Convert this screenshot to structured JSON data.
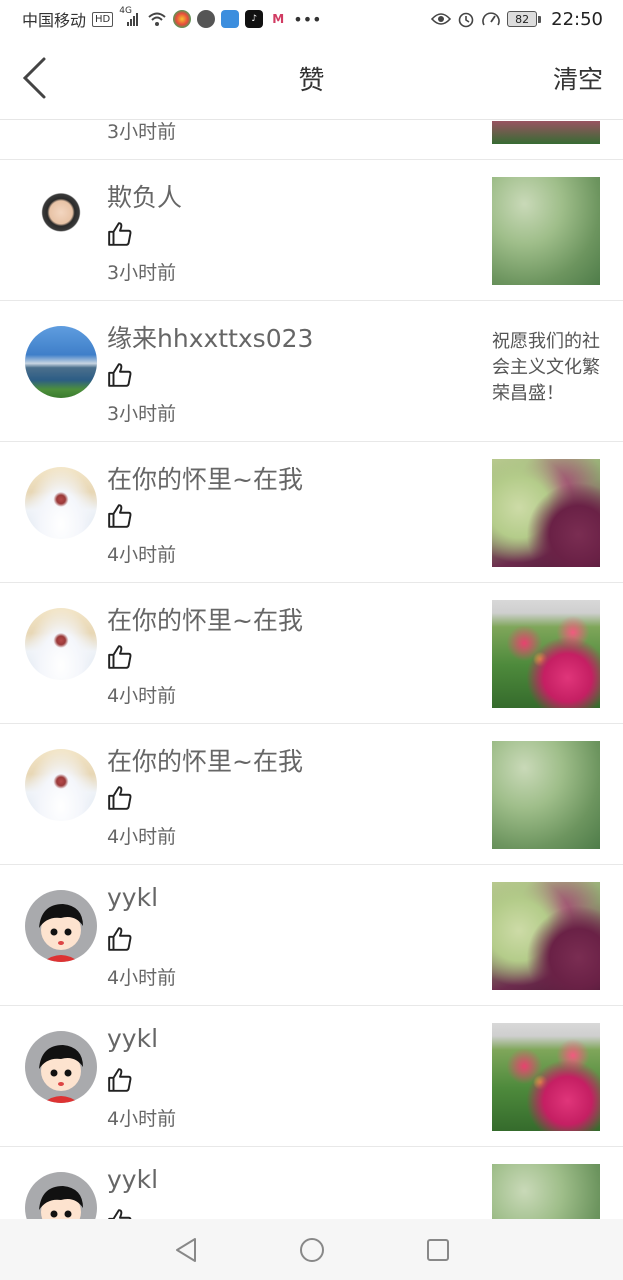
{
  "status_bar": {
    "carrier": "中国移动",
    "hd": "HD",
    "network": "4G",
    "battery": "82",
    "time": "22:50"
  },
  "header": {
    "title": "赞",
    "clear_label": "清空"
  },
  "rows": [
    {
      "user": "",
      "time": "3小时前",
      "avatar": "avatar-unknown",
      "thumb": "th-top"
    },
    {
      "user": "欺负人",
      "time": "3小时前",
      "avatar": "av-girl",
      "thumb": "th-plant"
    },
    {
      "user": "缘来hhxxttxs023",
      "time": "3小时前",
      "avatar": "av-lake",
      "text": "祝愿我们的社会主义文化繁荣昌盛！"
    },
    {
      "user": "在你的怀里~在我",
      "time": "4小时前",
      "avatar": "av-bride",
      "thumb": "th-purple"
    },
    {
      "user": "在你的怀里~在我",
      "time": "4小时前",
      "avatar": "av-bride",
      "thumb": "th-roses"
    },
    {
      "user": "在你的怀里~在我",
      "time": "4小时前",
      "avatar": "av-bride",
      "thumb": "th-plant"
    },
    {
      "user": "yykl",
      "time": "4小时前",
      "avatar": "av-cartoon",
      "thumb": "th-purple"
    },
    {
      "user": "yykl",
      "time": "4小时前",
      "avatar": "av-cartoon",
      "thumb": "th-roses"
    },
    {
      "user": "yykl",
      "time": "",
      "avatar": "av-cartoon",
      "thumb": "th-plant"
    }
  ],
  "colors": {
    "text_primary": "#333333",
    "text_secondary": "#666666",
    "divider": "#e8e8e8"
  }
}
